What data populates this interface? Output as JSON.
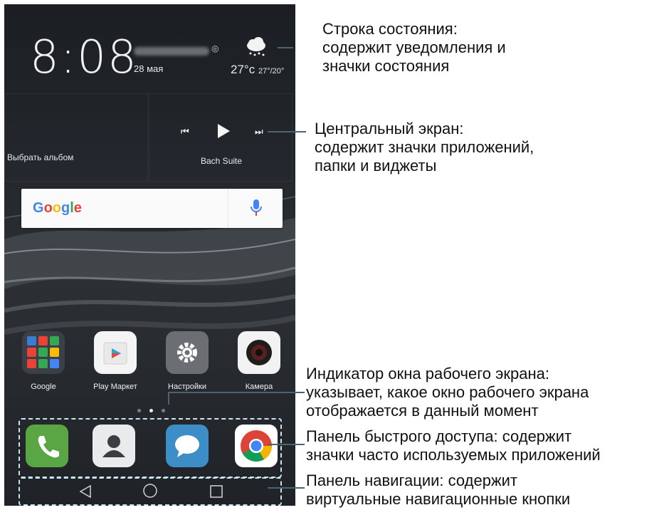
{
  "status": {
    "time": "8:08",
    "date": "28 мая",
    "temperature": "27°c",
    "temp_range": "27°/20°"
  },
  "widget": {
    "album_label": "Выбрать альбом",
    "track_name": "Bach Suite"
  },
  "search": {
    "logo": "Google"
  },
  "apps": [
    {
      "label": "Google",
      "icon": "google-folder-icon"
    },
    {
      "label": "Play Маркет",
      "icon": "play-store-icon"
    },
    {
      "label": "Настройки",
      "icon": "settings-gear-icon"
    },
    {
      "label": "Камера",
      "icon": "camera-icon"
    }
  ],
  "pager": {
    "pages": 3,
    "current": 1
  },
  "dock": [
    {
      "icon": "phone-icon",
      "color": "#5aa645"
    },
    {
      "icon": "contacts-icon",
      "color": "#e9eaec"
    },
    {
      "icon": "messages-icon",
      "color": "#3d8ec6"
    },
    {
      "icon": "chrome-icon",
      "color": "#ffffff"
    }
  ],
  "nav": [
    {
      "icon": "back-triangle-icon"
    },
    {
      "icon": "home-circle-icon"
    },
    {
      "icon": "recents-square-icon"
    }
  ],
  "callouts": {
    "status_bar": [
      "Строка состояния:",
      "содержит уведомления и",
      "значки состояния"
    ],
    "home_screen": [
      "Центральный экран:",
      "содержит значки приложений,",
      "папки и виджеты"
    ],
    "indicator": [
      "Индикатор окна рабочего экрана:",
      "указывает, какое окно рабочего экрана",
      "отображается в данный момент"
    ],
    "dock": [
      "Панель быстрого доступа: содержит",
      "значки часто используемых приложений"
    ],
    "navigation": [
      "Панель навигации: содержит",
      "виртуальные навигационные кнопки"
    ]
  }
}
